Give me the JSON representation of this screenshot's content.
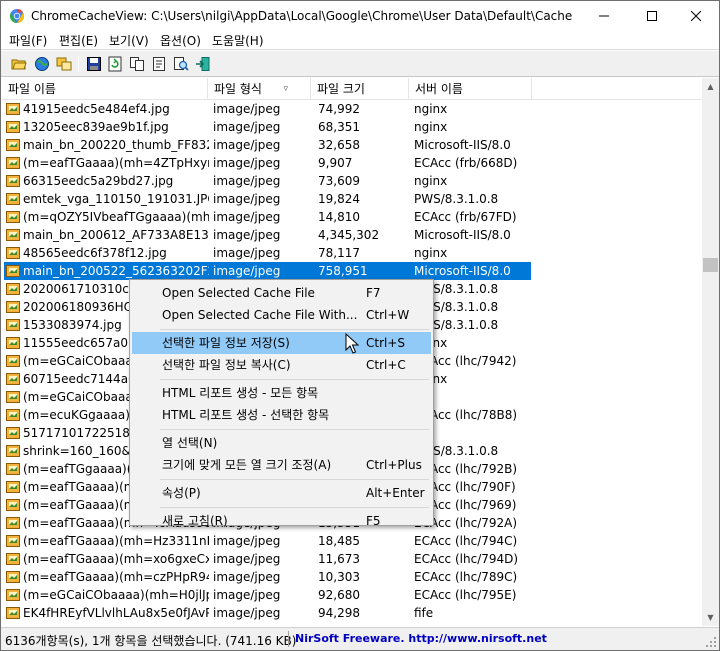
{
  "window": {
    "title": "ChromeCacheView:   C:\\Users\\nilgi\\AppData\\Local\\Google\\Chrome\\User Data\\Default\\Cache"
  },
  "menu": [
    "파일(F)",
    "편집(E)",
    "보기(V)",
    "옵션(O)",
    "도움말(H)"
  ],
  "toolbar": {
    "icons": [
      "open-folder-icon",
      "globe-icon",
      "copy-files-icon",
      "save-icon",
      "refresh-icon",
      "copy-icon",
      "properties-icon",
      "find-icon",
      "exit-icon"
    ]
  },
  "columns": [
    "파일 이름",
    "파일 형식",
    "파일 크기",
    "서버 이름"
  ],
  "rows": [
    {
      "name": "41915eedc5e484ef4.jpg",
      "type": "image/jpeg",
      "size": "74,992",
      "server": "nginx"
    },
    {
      "name": "13205eec839ae9b1f.jpg",
      "type": "image/jpeg",
      "size": "68,351",
      "server": "nginx"
    },
    {
      "name": "main_bn_200220_thumb_FF8321...",
      "type": "image/jpeg",
      "size": "32,658",
      "server": "Microsoft-IIS/8.0"
    },
    {
      "name": "(m=eafTGaaaa)(mh=4ZTpHxyrjf...",
      "type": "image/jpeg",
      "size": "9,907",
      "server": "ECAcc (frb/668D)"
    },
    {
      "name": "66315eedc5a29bd27.jpg",
      "type": "image/jpeg",
      "size": "73,609",
      "server": "nginx"
    },
    {
      "name": "emtek_vga_110150_191031.JPG",
      "type": "image/jpeg",
      "size": "19,824",
      "server": "PWS/8.3.1.0.8"
    },
    {
      "name": "(m=qOZY5IVbeafTGgaaaa)(mh=0...",
      "type": "image/jpeg",
      "size": "14,810",
      "server": "ECAcc (frb/67FD)"
    },
    {
      "name": "main_bn_200612_AF733A8E139E...",
      "type": "image/jpeg",
      "size": "4,345,302",
      "server": "Microsoft-IIS/8.0"
    },
    {
      "name": "48565eedc6f378f12.jpg",
      "type": "image/jpeg",
      "size": "78,117",
      "server": "nginx"
    },
    {
      "name": "main_bn_200522_562363202F24...",
      "type": "image/jpeg",
      "size": "758,951",
      "server": "Microsoft-IIS/8.0",
      "selected": true
    },
    {
      "name": "2020061710310cb8v",
      "type": "",
      "size": "",
      "server": "PWS/8.3.1.0.8"
    },
    {
      "name": "202006180936HQK",
      "type": "",
      "size": "",
      "server": "PWS/8.3.1.0.8"
    },
    {
      "name": "1533083974.jpg",
      "type": "",
      "size": "",
      "server": "PWS/8.3.1.0.8"
    },
    {
      "name": "11555eedc657a075",
      "type": "",
      "size": "",
      "server": "nginx"
    },
    {
      "name": "(m=eGCaiCObaaaa)(",
      "type": "",
      "size": "",
      "server": "ECAcc (lhc/7942)"
    },
    {
      "name": "60715eedc7144a6e9",
      "type": "",
      "size": "",
      "server": "nginx"
    },
    {
      "name": "(m=eGCaiCObaaaa)(",
      "type": "",
      "size": "",
      "server": ""
    },
    {
      "name": "(m=ecuKGgaaaa)(mh",
      "type": "",
      "size": "",
      "server": "ECAcc (lhc/78B8)"
    },
    {
      "name": "5171710172251878",
      "type": "",
      "size": "",
      "server": ""
    },
    {
      "name": "shrink=160_160&_v=",
      "type": "",
      "size": "",
      "server": "PWS/8.3.1.0.8"
    },
    {
      "name": "(m=eafTGgaaaa)(mh",
      "type": "",
      "size": "",
      "server": "ECAcc (lhc/792B)"
    },
    {
      "name": "(m=eafTGaaaa)(mh",
      "type": "",
      "size": "",
      "server": "ECAcc (lhc/790F)"
    },
    {
      "name": "(m=eafTGaaaa)(mh",
      "type": "",
      "size": "",
      "server": "ECAcc (lhc/7969)"
    },
    {
      "name": "(m=eafTGaaaa)(mh=YoAddsoOL...",
      "type": "image/jpeg",
      "size": "15,351",
      "server": "ECAcc (lhc/792A)"
    },
    {
      "name": "(m=eafTGaaaa)(mh=Hz3311nRv...",
      "type": "image/jpeg",
      "size": "18,485",
      "server": "ECAcc (lhc/794C)"
    },
    {
      "name": "(m=eafTGaaaa)(mh=xo6gxeCxIk...",
      "type": "image/jpeg",
      "size": "11,673",
      "server": "ECAcc (lhc/794D)"
    },
    {
      "name": "(m=eafTGaaaa)(mh=czPHpR949...",
      "type": "image/jpeg",
      "size": "10,303",
      "server": "ECAcc (lhc/789C)"
    },
    {
      "name": "(m=eGCaiCObaaaa)(mh=H0jlJpJh...",
      "type": "image/jpeg",
      "size": "92,680",
      "server": "ECAcc (lhc/795E)"
    },
    {
      "name": "EK4fHREyfVLlvlhLAu8x5e0fJAvPR...",
      "type": "image/jpeg",
      "size": "94,298",
      "server": "fife"
    }
  ],
  "context_menu": [
    {
      "label": "Open Selected Cache File",
      "shortcut": "F7"
    },
    {
      "label": "Open Selected Cache File With...",
      "shortcut": "Ctrl+W"
    },
    {
      "separator": true
    },
    {
      "label": "선택한 파일 정보 저장(S)",
      "shortcut": "Ctrl+S",
      "hover": true
    },
    {
      "label": "선택한 파일 정보 복사(C)",
      "shortcut": "Ctrl+C"
    },
    {
      "separator": true
    },
    {
      "label": "HTML 리포트 생성 - 모든 항목",
      "shortcut": ""
    },
    {
      "label": "HTML 리포트 생성 - 선택한 항목",
      "shortcut": ""
    },
    {
      "separator": true
    },
    {
      "label": "열 선택(N)",
      "shortcut": ""
    },
    {
      "label": "크기에 맞게 모든 열 크기 조정(A)",
      "shortcut": "Ctrl+Plus"
    },
    {
      "separator": true
    },
    {
      "label": "속성(P)",
      "shortcut": "Alt+Enter"
    },
    {
      "separator": true
    },
    {
      "label": "새로 고침(R)",
      "shortcut": "F5"
    }
  ],
  "status": {
    "left": "6136개항목(s), 1개 항목을 선택했습니다.  (741.16 KB)",
    "right": "NirSoft Freeware.  http://www.nirsoft.net"
  }
}
